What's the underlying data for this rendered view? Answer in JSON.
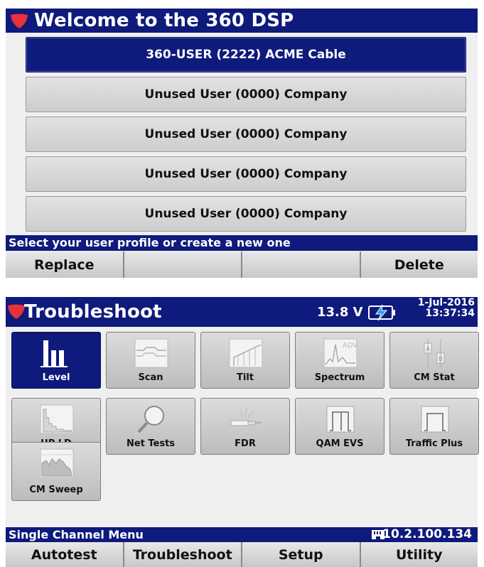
{
  "welcome": {
    "title": "Welcome to the 360 DSP",
    "users": [
      {
        "label": "360-USER (2222) ACME Cable",
        "selected": true
      },
      {
        "label": "Unused User (0000) Company",
        "selected": false
      },
      {
        "label": "Unused User (0000) Company",
        "selected": false
      },
      {
        "label": "Unused User (0000) Company",
        "selected": false
      },
      {
        "label": "Unused User (0000) Company",
        "selected": false
      }
    ],
    "status": "Select your user profile or create a new one",
    "softkeys": [
      "Replace",
      "",
      "",
      "Delete"
    ]
  },
  "troubleshoot": {
    "title": "Troubleshoot",
    "voltage": "13.8 V",
    "date": "1-Jul-2016",
    "time": "13:37:34",
    "tiles": [
      {
        "label": "Level",
        "icon": "level-icon",
        "selected": true
      },
      {
        "label": "Scan",
        "icon": "scan-icon"
      },
      {
        "label": "Tilt",
        "icon": "tilt-icon"
      },
      {
        "label": "Spectrum",
        "icon": "spectrum-icon"
      },
      {
        "label": "CM Stat",
        "icon": "cm-stat-icon"
      },
      {
        "label": "UP LD",
        "icon": "up-ld-icon"
      },
      {
        "label": "Net Tests",
        "icon": "magnifier-icon"
      },
      {
        "label": "FDR",
        "icon": "fdr-icon"
      },
      {
        "label": "QAM EVS",
        "icon": "qam-evs-icon"
      },
      {
        "label": "Traffic Plus",
        "icon": "traffic-plus-icon"
      },
      {
        "label": "CM Sweep",
        "icon": "cm-sweep-icon"
      }
    ],
    "status": "Single Channel Menu",
    "ip": "10.2.100.134",
    "softkeys": [
      "Autotest",
      "Troubleshoot",
      "Setup",
      "Utility"
    ]
  },
  "colors": {
    "accent": "#0e1a7c",
    "shield": "#e8313a",
    "battery_bolt": "#2a9df4"
  }
}
